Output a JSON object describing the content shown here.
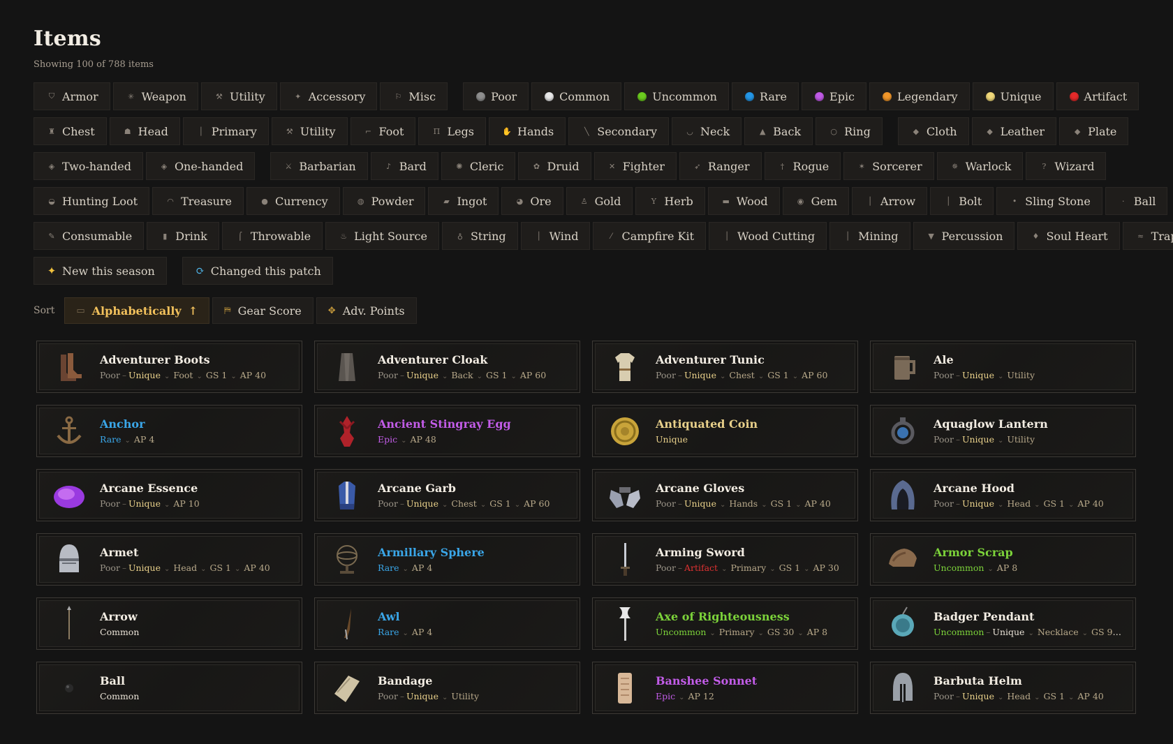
{
  "header": {
    "title": "Items",
    "subtitle": "Showing 100 of 788 items"
  },
  "filter_rows": [
    [
      [
        {
          "label": "Armor",
          "icon": "armor-icon",
          "glyph": "⛉"
        },
        {
          "label": "Weapon",
          "icon": "weapon-icon",
          "glyph": "✳"
        },
        {
          "label": "Utility",
          "icon": "utility-icon",
          "glyph": "⚒"
        },
        {
          "label": "Accessory",
          "icon": "accessory-icon",
          "glyph": "✦"
        },
        {
          "label": "Misc",
          "icon": "misc-icon",
          "glyph": "⚐"
        }
      ],
      [
        {
          "label": "Poor",
          "dot": "#8f8f8f"
        },
        {
          "label": "Common",
          "dot": "#e8e8e8"
        },
        {
          "label": "Uncommon",
          "dot": "#6ccc1f"
        },
        {
          "label": "Rare",
          "dot": "#2496e6"
        },
        {
          "label": "Epic",
          "dot": "#c05ae6"
        },
        {
          "label": "Legendary",
          "dot": "#f0962a"
        },
        {
          "label": "Unique",
          "dot": "#f1d97a"
        },
        {
          "label": "Artifact",
          "dot": "#e52a2a"
        }
      ]
    ],
    [
      [
        {
          "label": "Chest",
          "icon": "chest-icon",
          "glyph": "♜"
        },
        {
          "label": "Head",
          "icon": "head-icon",
          "glyph": "☗"
        },
        {
          "label": "Primary",
          "icon": "primary-icon",
          "glyph": "│"
        },
        {
          "label": "Utility",
          "icon": "utility-icon",
          "glyph": "⚒"
        },
        {
          "label": "Foot",
          "icon": "foot-icon",
          "glyph": "⌐"
        },
        {
          "label": "Legs",
          "icon": "legs-icon",
          "glyph": "Π"
        },
        {
          "label": "Hands",
          "icon": "hands-icon",
          "glyph": "✋"
        },
        {
          "label": "Secondary",
          "icon": "secondary-icon",
          "glyph": "╲"
        },
        {
          "label": "Neck",
          "icon": "neck-icon",
          "glyph": "◡"
        },
        {
          "label": "Back",
          "icon": "back-icon",
          "glyph": "▲"
        },
        {
          "label": "Ring",
          "icon": "ring-icon",
          "glyph": "○"
        }
      ],
      [
        {
          "label": "Cloth",
          "icon": "cloth-icon",
          "glyph": "◆"
        },
        {
          "label": "Leather",
          "icon": "leather-icon",
          "glyph": "◆"
        },
        {
          "label": "Plate",
          "icon": "plate-icon",
          "glyph": "◆"
        }
      ]
    ],
    [
      [
        {
          "label": "Two-handed",
          "icon": "two-handed-icon",
          "glyph": "◈"
        },
        {
          "label": "One-handed",
          "icon": "one-handed-icon",
          "glyph": "◈"
        }
      ],
      [
        {
          "label": "Barbarian",
          "icon": "barbarian-icon",
          "glyph": "⚔"
        },
        {
          "label": "Bard",
          "icon": "bard-icon",
          "glyph": "♪"
        },
        {
          "label": "Cleric",
          "icon": "cleric-icon",
          "glyph": "✺"
        },
        {
          "label": "Druid",
          "icon": "druid-icon",
          "glyph": "✿"
        },
        {
          "label": "Fighter",
          "icon": "fighter-icon",
          "glyph": "✕"
        },
        {
          "label": "Ranger",
          "icon": "ranger-icon",
          "glyph": "➶"
        },
        {
          "label": "Rogue",
          "icon": "rogue-icon",
          "glyph": "†"
        },
        {
          "label": "Sorcerer",
          "icon": "sorcerer-icon",
          "glyph": "✶"
        },
        {
          "label": "Warlock",
          "icon": "warlock-icon",
          "glyph": "✵"
        },
        {
          "label": "Wizard",
          "icon": "wizard-icon",
          "glyph": "?"
        }
      ]
    ],
    [
      [
        {
          "label": "Hunting Loot",
          "icon": "hunting-loot-icon",
          "glyph": "◒"
        },
        {
          "label": "Treasure",
          "icon": "treasure-icon",
          "glyph": "◠"
        },
        {
          "label": "Currency",
          "icon": "currency-icon",
          "glyph": "●"
        },
        {
          "label": "Powder",
          "icon": "powder-icon",
          "glyph": "◍"
        },
        {
          "label": "Ingot",
          "icon": "ingot-icon",
          "glyph": "▰"
        },
        {
          "label": "Ore",
          "icon": "ore-icon",
          "glyph": "◕"
        },
        {
          "label": "Gold",
          "icon": "gold-icon",
          "glyph": "♙"
        },
        {
          "label": "Herb",
          "icon": "herb-icon",
          "glyph": "Y"
        },
        {
          "label": "Wood",
          "icon": "wood-icon",
          "glyph": "▬"
        },
        {
          "label": "Gem",
          "icon": "gem-icon",
          "glyph": "◉"
        },
        {
          "label": "Arrow",
          "icon": "arrow-icon",
          "glyph": "│"
        },
        {
          "label": "Bolt",
          "icon": "bolt-icon",
          "glyph": "│"
        },
        {
          "label": "Sling Stone",
          "icon": "sling-stone-icon",
          "glyph": "•"
        },
        {
          "label": "Ball",
          "icon": "ball-icon",
          "glyph": "·"
        }
      ]
    ],
    [
      [
        {
          "label": "Consumable",
          "icon": "consumable-icon",
          "glyph": "✎"
        },
        {
          "label": "Drink",
          "icon": "drink-icon",
          "glyph": "▮"
        },
        {
          "label": "Throwable",
          "icon": "throwable-icon",
          "glyph": "⌠"
        },
        {
          "label": "Light Source",
          "icon": "light-source-icon",
          "glyph": "♨"
        },
        {
          "label": "String",
          "icon": "string-icon",
          "glyph": "♁"
        },
        {
          "label": "Wind",
          "icon": "wind-icon",
          "glyph": "│"
        },
        {
          "label": "Campfire Kit",
          "icon": "campfire-kit-icon",
          "glyph": "⁄"
        },
        {
          "label": "Wood Cutting",
          "icon": "wood-cutting-icon",
          "glyph": "│"
        },
        {
          "label": "Mining",
          "icon": "mining-icon",
          "glyph": "│"
        },
        {
          "label": "Percussion",
          "icon": "percussion-icon",
          "glyph": "▼"
        },
        {
          "label": "Soul Heart",
          "icon": "soul-heart-icon",
          "glyph": "♦"
        },
        {
          "label": "Trap",
          "icon": "trap-icon",
          "glyph": "≈"
        }
      ]
    ]
  ],
  "special_filters": [
    {
      "label": "New this season",
      "icon": "sparkle-icon",
      "glyph": "✦",
      "cls": "spark"
    },
    {
      "label": "Changed this patch",
      "icon": "refresh-icon",
      "glyph": "⟳",
      "cls": "cycle"
    }
  ],
  "sort": {
    "label": "Sort",
    "options": [
      {
        "label": "Alphabetically",
        "icon": "book-icon",
        "glyph": "▭",
        "active": true,
        "arrow": "↑"
      },
      {
        "label": "Gear Score",
        "icon": "gear-score-icon",
        "glyph": "⛿",
        "active": false
      },
      {
        "label": "Adv. Points",
        "icon": "adv-points-icon",
        "glyph": "✥",
        "active": false
      }
    ]
  },
  "items": [
    {
      "name": "Adventurer Boots",
      "icon": "boots-icon",
      "name_rarity": "poor",
      "tags": [
        {
          "t": "Poor",
          "r": "poor"
        },
        {
          "t": "Unique",
          "r": "unique",
          "dash": true
        },
        {
          "t": "Foot"
        },
        {
          "t": "GS 1"
        },
        {
          "t": "AP 40"
        }
      ]
    },
    {
      "name": "Adventurer Cloak",
      "icon": "cloak-icon",
      "name_rarity": "poor",
      "tags": [
        {
          "t": "Poor",
          "r": "poor"
        },
        {
          "t": "Unique",
          "r": "unique",
          "dash": true
        },
        {
          "t": "Back"
        },
        {
          "t": "GS 1"
        },
        {
          "t": "AP 60"
        }
      ]
    },
    {
      "name": "Adventurer Tunic",
      "icon": "tunic-icon",
      "name_rarity": "poor",
      "tags": [
        {
          "t": "Poor",
          "r": "poor"
        },
        {
          "t": "Unique",
          "r": "unique",
          "dash": true
        },
        {
          "t": "Chest"
        },
        {
          "t": "GS 1"
        },
        {
          "t": "AP 60"
        }
      ]
    },
    {
      "name": "Ale",
      "icon": "ale-mug-icon",
      "name_rarity": "poor",
      "tags": [
        {
          "t": "Poor",
          "r": "poor"
        },
        {
          "t": "Unique",
          "r": "unique",
          "dash": true
        },
        {
          "t": "Utility"
        }
      ]
    },
    {
      "name": "Anchor",
      "icon": "anchor-icon",
      "name_rarity": "rare",
      "tags": [
        {
          "t": "Rare",
          "r": "rare"
        },
        {
          "t": "AP 4"
        }
      ]
    },
    {
      "name": "Ancient Stingray Egg",
      "icon": "stingray-egg-icon",
      "name_rarity": "epic",
      "tags": [
        {
          "t": "Epic",
          "r": "epic"
        },
        {
          "t": "AP 48"
        }
      ]
    },
    {
      "name": "Antiquated Coin",
      "icon": "coin-icon",
      "name_rarity": "unique",
      "tags": [
        {
          "t": "Unique",
          "r": "unique"
        }
      ]
    },
    {
      "name": "Aquaglow Lantern",
      "icon": "lantern-icon",
      "name_rarity": "poor",
      "tags": [
        {
          "t": "Poor",
          "r": "poor"
        },
        {
          "t": "Unique",
          "r": "unique",
          "dash": true
        },
        {
          "t": "Utility"
        }
      ]
    },
    {
      "name": "Arcane Essence",
      "icon": "essence-icon",
      "name_rarity": "poor",
      "tags": [
        {
          "t": "Poor",
          "r": "poor"
        },
        {
          "t": "Unique",
          "r": "unique",
          "dash": true
        },
        {
          "t": "AP 10"
        }
      ]
    },
    {
      "name": "Arcane Garb",
      "icon": "garb-icon",
      "name_rarity": "poor",
      "tags": [
        {
          "t": "Poor",
          "r": "poor"
        },
        {
          "t": "Unique",
          "r": "unique",
          "dash": true
        },
        {
          "t": "Chest"
        },
        {
          "t": "GS 1"
        },
        {
          "t": "AP 60"
        }
      ]
    },
    {
      "name": "Arcane Gloves",
      "icon": "gloves-icon",
      "name_rarity": "poor",
      "tags": [
        {
          "t": "Poor",
          "r": "poor"
        },
        {
          "t": "Unique",
          "r": "unique",
          "dash": true
        },
        {
          "t": "Hands"
        },
        {
          "t": "GS 1"
        },
        {
          "t": "AP 40"
        }
      ]
    },
    {
      "name": "Arcane Hood",
      "icon": "hood-icon",
      "name_rarity": "poor",
      "tags": [
        {
          "t": "Poor",
          "r": "poor"
        },
        {
          "t": "Unique",
          "r": "unique",
          "dash": true
        },
        {
          "t": "Head"
        },
        {
          "t": "GS 1"
        },
        {
          "t": "AP 40"
        }
      ]
    },
    {
      "name": "Armet",
      "icon": "armet-helm-icon",
      "name_rarity": "poor",
      "tags": [
        {
          "t": "Poor",
          "r": "poor"
        },
        {
          "t": "Unique",
          "r": "unique",
          "dash": true
        },
        {
          "t": "Head"
        },
        {
          "t": "GS 1"
        },
        {
          "t": "AP 40"
        }
      ]
    },
    {
      "name": "Armillary Sphere",
      "icon": "armillary-sphere-icon",
      "name_rarity": "rare",
      "tags": [
        {
          "t": "Rare",
          "r": "rare"
        },
        {
          "t": "AP 4"
        }
      ]
    },
    {
      "name": "Arming Sword",
      "icon": "sword-icon",
      "name_rarity": "poor",
      "tags": [
        {
          "t": "Poor",
          "r": "poor"
        },
        {
          "t": "Artifact",
          "r": "artifact",
          "dash": true
        },
        {
          "t": "Primary"
        },
        {
          "t": "GS 1"
        },
        {
          "t": "AP 30"
        }
      ]
    },
    {
      "name": "Armor Scrap",
      "icon": "armor-scrap-icon",
      "name_rarity": "uncommon",
      "tags": [
        {
          "t": "Uncommon",
          "r": "uncommon"
        },
        {
          "t": "AP 8"
        }
      ]
    },
    {
      "name": "Arrow",
      "icon": "arrow-item-icon",
      "name_rarity": "common",
      "tags": [
        {
          "t": "Common",
          "r": "common"
        }
      ]
    },
    {
      "name": "Awl",
      "icon": "awl-icon",
      "name_rarity": "rare",
      "tags": [
        {
          "t": "Rare",
          "r": "rare"
        },
        {
          "t": "AP 4"
        }
      ]
    },
    {
      "name": "Axe of Righteousness",
      "icon": "axe-icon",
      "name_rarity": "uncommon",
      "tags": [
        {
          "t": "Uncommon",
          "r": "uncommon"
        },
        {
          "t": "Primary"
        },
        {
          "t": "GS 30"
        },
        {
          "t": "AP 8"
        }
      ]
    },
    {
      "name": "Badger Pendant",
      "icon": "pendant-icon",
      "name_rarity": "poor",
      "tags": [
        {
          "t": "Uncommon",
          "r": "uncommon"
        },
        {
          "t": "Unique",
          "r": "common",
          "dash": true
        },
        {
          "t": "Necklace"
        },
        {
          "t": "GS 9"
        },
        {
          "t": "A…"
        }
      ]
    },
    {
      "name": "Ball",
      "icon": "ball-item-icon",
      "name_rarity": "common",
      "tags": [
        {
          "t": "Common",
          "r": "common"
        }
      ]
    },
    {
      "name": "Bandage",
      "icon": "bandage-icon",
      "name_rarity": "poor",
      "tags": [
        {
          "t": "Poor",
          "r": "poor"
        },
        {
          "t": "Unique",
          "r": "unique",
          "dash": true
        },
        {
          "t": "Utility"
        }
      ]
    },
    {
      "name": "Banshee Sonnet",
      "icon": "scroll-icon",
      "name_rarity": "epic",
      "tags": [
        {
          "t": "Epic",
          "r": "epic"
        },
        {
          "t": "AP 12"
        }
      ]
    },
    {
      "name": "Barbuta Helm",
      "icon": "barbuta-helm-icon",
      "name_rarity": "poor",
      "tags": [
        {
          "t": "Poor",
          "r": "poor"
        },
        {
          "t": "Unique",
          "r": "unique",
          "dash": true
        },
        {
          "t": "Head"
        },
        {
          "t": "GS 1"
        },
        {
          "t": "AP 40"
        }
      ]
    }
  ]
}
